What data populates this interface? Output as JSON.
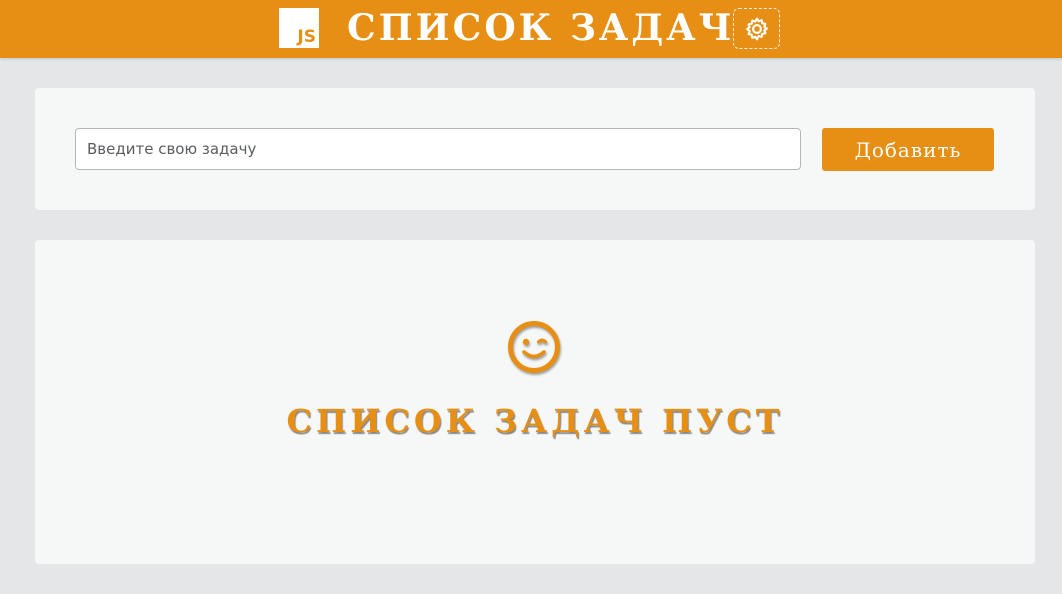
{
  "header": {
    "logo_text": "JS",
    "title": "СПИСОК ЗАДАЧ",
    "settings_icon": "gear-icon"
  },
  "task_form": {
    "input_placeholder": "Введите свою задачу",
    "input_value": "",
    "add_button_label": "Добавить"
  },
  "task_list": {
    "empty_icon": "wink-face-icon",
    "empty_message": "СПИСОК ЗАДАЧ ПУСТ"
  },
  "colors": {
    "accent": "#e68f14",
    "page_background": "#e5e6e8",
    "card_background": "#f6f7f7"
  }
}
